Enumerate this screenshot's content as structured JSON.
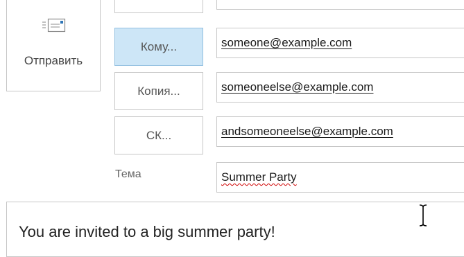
{
  "compose": {
    "send_label": "Отправить",
    "to_button_label": "Кому...",
    "cc_button_label": "Копия...",
    "bcc_button_label": "СК...",
    "to_value": "someone@example.com",
    "cc_value": "someoneelse@example.com",
    "bcc_value": "andsomeoneelse@example.com",
    "subject_label": "Тема",
    "subject_value": "Summer Party",
    "body_text": "You are invited to a big summer party!"
  },
  "icons": {
    "send": "send-envelope-icon",
    "cursor": "text-cursor-icon"
  },
  "colors": {
    "active_button_bg": "#cde6f7",
    "active_button_border": "#92c0e0",
    "border": "#c6c6c6",
    "spelling_error": "#d00000"
  }
}
